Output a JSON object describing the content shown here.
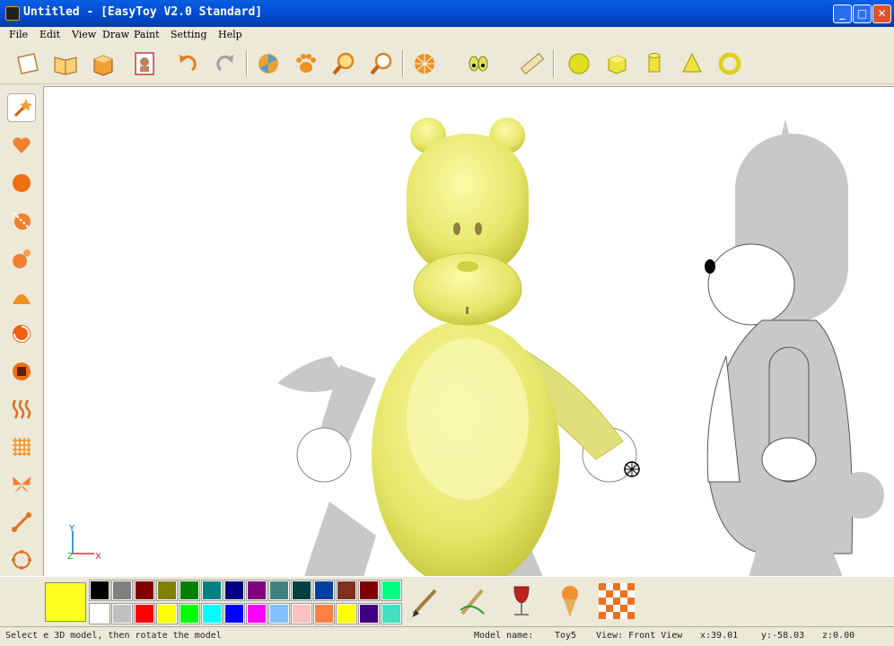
{
  "window": {
    "title": "Untitled - [EasyToy V2.0 Standard]",
    "minimize_glyph": "_",
    "maximize_glyph": "□",
    "close_glyph": "✕"
  },
  "menu": [
    "File",
    "Edit",
    "View",
    "Draw",
    "Paint",
    "Setting",
    "Help"
  ],
  "toolbar_icons": [
    "new-page-icon",
    "open-book-icon",
    "open-box-icon",
    "toy-template-icon",
    "undo-icon",
    "redo-icon",
    "pinwheel-icon",
    "paw-icon",
    "zoom-in-icon",
    "zoom-out-icon",
    "texture-ball-icon",
    "eyes-icon",
    "ruler-icon",
    "sphere-icon",
    "cube-icon",
    "cylinder-icon",
    "cone-icon",
    "torus-icon"
  ],
  "left_tool_icons": [
    "magic-wand-icon",
    "heart-shape-icon",
    "ellipse-icon",
    "cut-icon",
    "joint-icon",
    "bulge-icon",
    "rotate-icon",
    "button-icon",
    "wave-icon",
    "grid-icon",
    "butterfly-icon",
    "bone-icon",
    "outline-icon"
  ],
  "axis": {
    "y_label": "Y",
    "z_label": "Z",
    "x_label": "X"
  },
  "colors": {
    "current": "#ffff20",
    "toy_fill": "#e6e66a",
    "palette_row1": [
      "#000000",
      "#808080",
      "#800000",
      "#808000",
      "#008000",
      "#008080",
      "#000080",
      "#800080",
      "#408080",
      "#004040",
      "#0040a0",
      "#803020",
      "#800000",
      "#00ff80"
    ],
    "palette_row2": [
      "#ffffff",
      "#c0c0c0",
      "#ff0000",
      "#ffff00",
      "#00ff00",
      "#00ffff",
      "#0000ff",
      "#ff00ff",
      "#80c0ff",
      "#ffc0c0",
      "#ff8040",
      "#ffff00",
      "#400080",
      "#40e0c0"
    ]
  },
  "paint_tools": [
    "brush-icon",
    "airbrush-icon",
    "wine-glass-icon",
    "ice-cream-icon",
    "checker-icon"
  ],
  "status": {
    "hint": "Select e 3D model, then rotate the model",
    "model_name_label": "Model name:",
    "model_name": "Toy5",
    "view": "View: Front View",
    "x": "x:39.01",
    "y": "y:-58.03",
    "z": "z:0.00"
  }
}
